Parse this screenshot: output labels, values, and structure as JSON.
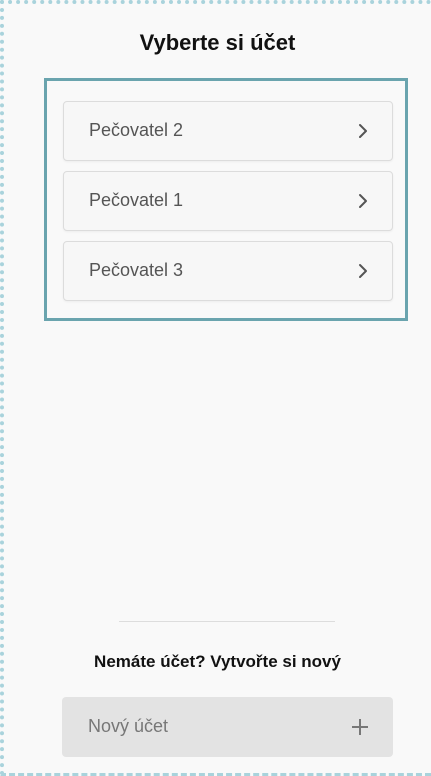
{
  "header": {
    "title": "Vyberte si účet"
  },
  "accounts": [
    {
      "label": "Pečovatel 2",
      "icon": "chevron-right-icon"
    },
    {
      "label": "Pečovatel 1",
      "icon": "chevron-right-icon"
    },
    {
      "label": "Pečovatel 3",
      "icon": "chevron-right-icon"
    }
  ],
  "footer": {
    "prompt": "Nemáte účet? Vytvořte si nový",
    "new_account_label": "Nový účet",
    "new_account_icon": "plus-icon"
  },
  "colors": {
    "panel_border": "#6aa4ae",
    "frame_dots": "#a9d3dc",
    "new_account_bg": "#e3e3e3"
  }
}
